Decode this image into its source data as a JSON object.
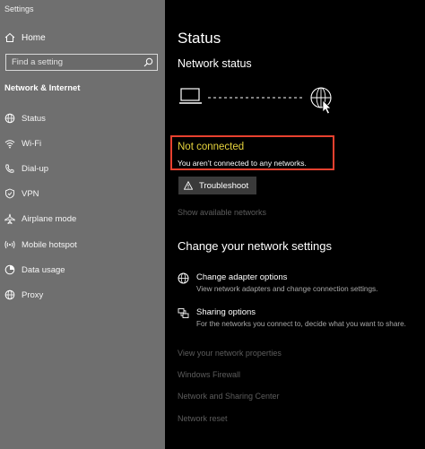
{
  "window": {
    "title": "Settings"
  },
  "sidebar": {
    "home_label": "Home",
    "search_placeholder": "Find a setting",
    "section_label": "Network & Internet",
    "items": [
      {
        "label": "Status",
        "icon": "home-globe-icon"
      },
      {
        "label": "Wi-Fi",
        "icon": "wifi-icon"
      },
      {
        "label": "Dial-up",
        "icon": "dialup-icon"
      },
      {
        "label": "VPN",
        "icon": "vpn-icon"
      },
      {
        "label": "Airplane mode",
        "icon": "airplane-icon"
      },
      {
        "label": "Mobile hotspot",
        "icon": "hotspot-icon"
      },
      {
        "label": "Data usage",
        "icon": "data-usage-icon"
      },
      {
        "label": "Proxy",
        "icon": "proxy-globe-icon"
      }
    ]
  },
  "main": {
    "title": "Status",
    "network_status_heading": "Network status",
    "alert_title": "Not connected",
    "alert_desc": "You aren’t connected to any networks.",
    "troubleshoot_label": "Troubleshoot",
    "show_available": "Show available networks",
    "change_heading": "Change your network settings",
    "options": [
      {
        "title": "Change adapter options",
        "desc": "View network adapters and change connection settings.",
        "icon": "adapter-icon"
      },
      {
        "title": "Sharing options",
        "desc": "For the networks you connect to, decide what you want to share.",
        "icon": "sharing-icon"
      }
    ],
    "links": [
      "View your network properties",
      "Windows Firewall",
      "Network and Sharing Center",
      "Network reset"
    ]
  },
  "colors": {
    "sidebar_bg": "#6f6f6f",
    "content_bg": "#000000",
    "alert_title": "#e6d33d",
    "highlight_border": "#e8412f",
    "disabled_link": "#5d5d5d"
  }
}
